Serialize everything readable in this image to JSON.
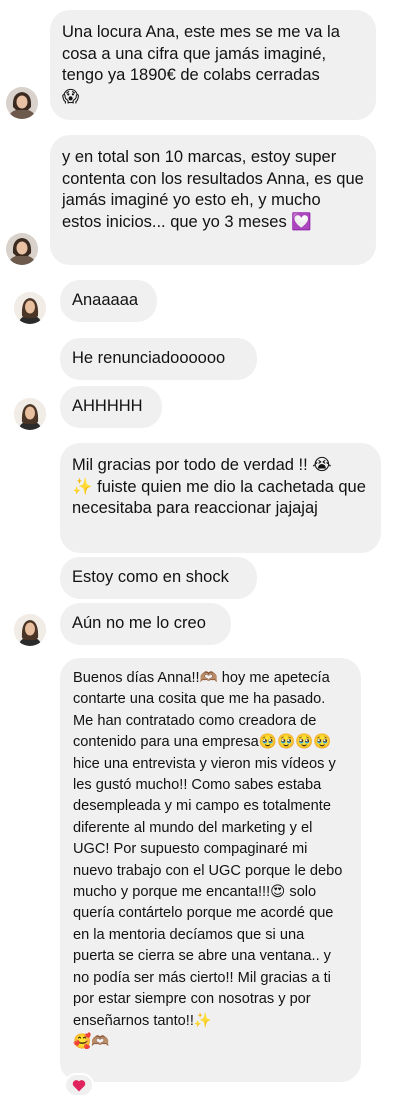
{
  "messages": [
    {
      "text": "Una locura Ana, este mes se me va la cosa a una cifra que jamás imaginé, tengo ya 1890€ de colabs cerradas\n😱"
    },
    {
      "text": "y en total son 10 marcas, estoy super contenta con los resultados Anna, es que jamás imaginé yo esto eh, y mucho estos inicios... que yo 3 meses 💟"
    },
    {
      "text": "Anaaaaa"
    },
    {
      "text": "He renunciadoooooo"
    },
    {
      "text": "AHHHHH"
    },
    {
      "text": "Mil gracias por todo de verdad !! 😭\n✨ fuiste quien me dio la cachetada que necesitaba para reaccionar jajajaj"
    },
    {
      "text": "Estoy como en shock"
    },
    {
      "text": "Aún no me lo creo"
    },
    {
      "text": "Buenos días Anna!!🫶🏽 hoy me apetecía contarte una cosita que me ha pasado. Me han contratado como creadora de contenido para una empresa🥹🥹🥹🥹 hice una entrevista y vieron mis vídeos y les gustó mucho!! Como sabes estaba desempleada y mi campo es totalmente diferente al mundo del marketing y el UGC! Por supuesto compaginaré mi nuevo trabajo con el UGC porque le debo mucho y porque me encanta!!!😍 solo quería contártelo porque me acordé que en la mentoria decíamos que si una puerta se cierra se abre una ventana.. y no podía ser más cierto!! Mil gracias a ti por estar siempre con nosotras y por enseñarnos tanto!!✨\n🥰🫶🏽"
    }
  ],
  "reaction": {
    "emoji": "heart-icon",
    "color": "#e0245e"
  },
  "colors": {
    "bubble": "#f0f0f0",
    "text": "#121212",
    "background": "#ffffff"
  }
}
